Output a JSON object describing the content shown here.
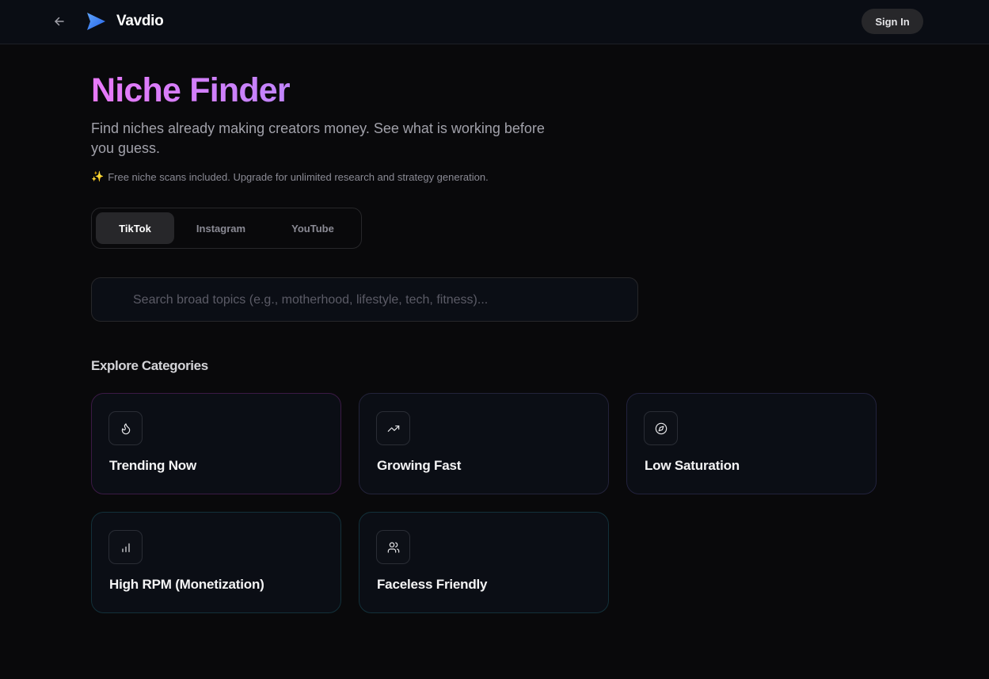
{
  "header": {
    "brand": "Vavdio",
    "sign_in_label": "Sign In",
    "accent": "#3b82f6"
  },
  "hero": {
    "title": "Niche Finder",
    "subtitle": "Find niches already making creators money. See what is working before you guess.",
    "note": "Free niche scans included. Upgrade for unlimited research and strategy generation.",
    "note_icon": "sparkles-icon",
    "title_gradient": [
      "#e879f9",
      "#c084fc"
    ]
  },
  "platform_tabs": {
    "selected": "TikTok",
    "items": [
      {
        "label": "TikTok"
      },
      {
        "label": "Instagram"
      },
      {
        "label": "YouTube"
      }
    ]
  },
  "search": {
    "value": "",
    "placeholder": "Search broad topics (e.g., motherhood, lifestyle, tech, fitness)..."
  },
  "categories": {
    "title": "Explore Categories",
    "items": [
      {
        "label": "Trending Now",
        "icon": "flame-icon",
        "border": "#3b1a45"
      },
      {
        "label": "Growing Fast",
        "icon": "trending-up-icon",
        "border": "#23233a"
      },
      {
        "label": "Low Saturation",
        "icon": "compass-icon",
        "border": "#22223d"
      },
      {
        "label": "High RPM (Monetization)",
        "icon": "bar-chart-icon",
        "border": "#13313a"
      },
      {
        "label": "Faceless Friendly",
        "icon": "users-icon",
        "border": "#13313a"
      }
    ]
  }
}
